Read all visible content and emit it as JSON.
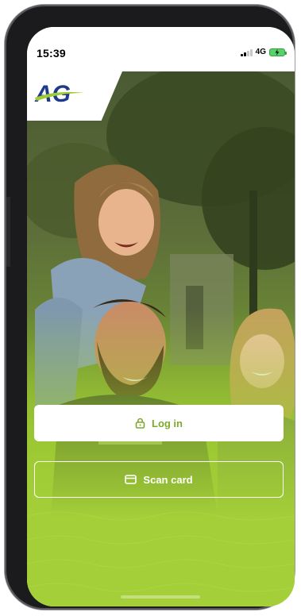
{
  "status_bar": {
    "time": "15:39",
    "network": "4G"
  },
  "brand": {
    "logo_text": "AG",
    "logo_color": "#1e3a8a",
    "accent_color": "#9fcb34"
  },
  "actions": {
    "login_label": "Log in",
    "scan_label": "Scan card"
  },
  "icons": {
    "login": "lock-icon",
    "scan": "card-icon",
    "battery": "battery-charging-icon",
    "signal": "signal-icon"
  }
}
